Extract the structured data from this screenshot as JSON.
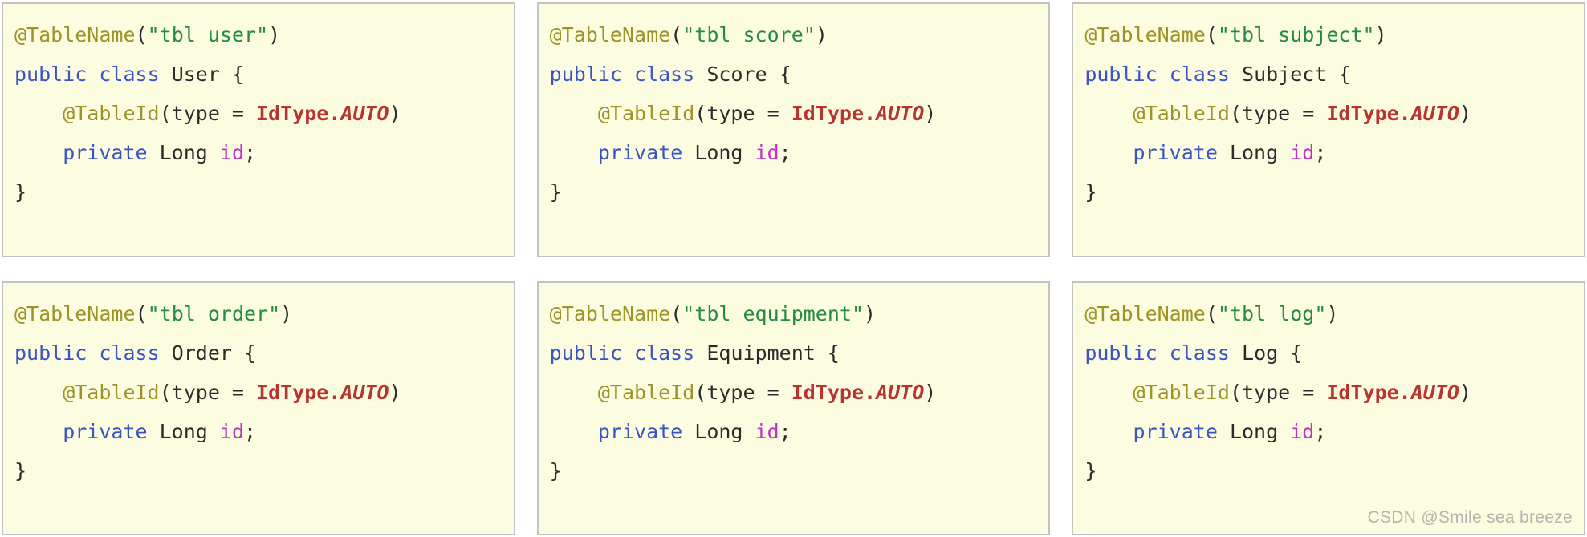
{
  "watermark": "CSDN @Smile sea breeze",
  "syntax_colors": {
    "background": "#fcfce0",
    "border": "#c3c3c3",
    "annotation": "#9e9326",
    "string": "#248c3f",
    "keyword": "#3a53c8",
    "constant": "#b9342f",
    "field": "#c033c0",
    "plain": "#2b2b2b"
  },
  "panels": [
    {
      "table_name": "tbl_user",
      "class_name": "User",
      "lines": {
        "annotation_name": "@TableName",
        "open_paren": "(",
        "quote": "\"",
        "close_paren": ")",
        "keyword_public": "public",
        "keyword_class": "class",
        "open_brace": "{",
        "close_brace": "}",
        "annotation_id": "@TableId",
        "id_args_prefix": "(type = ",
        "id_type": "IdType.",
        "id_auto": "AUTO",
        "keyword_private": "private",
        "field_type": "Long",
        "field_name": "id",
        "semicolon": ";"
      }
    },
    {
      "table_name": "tbl_score",
      "class_name": "Score",
      "lines": {
        "annotation_name": "@TableName",
        "open_paren": "(",
        "quote": "\"",
        "close_paren": ")",
        "keyword_public": "public",
        "keyword_class": "class",
        "open_brace": "{",
        "close_brace": "}",
        "annotation_id": "@TableId",
        "id_args_prefix": "(type = ",
        "id_type": "IdType.",
        "id_auto": "AUTO",
        "keyword_private": "private",
        "field_type": "Long",
        "field_name": "id",
        "semicolon": ";"
      }
    },
    {
      "table_name": "tbl_subject",
      "class_name": "Subject",
      "lines": {
        "annotation_name": "@TableName",
        "open_paren": "(",
        "quote": "\"",
        "close_paren": ")",
        "keyword_public": "public",
        "keyword_class": "class",
        "open_brace": "{",
        "close_brace": "}",
        "annotation_id": "@TableId",
        "id_args_prefix": "(type = ",
        "id_type": "IdType.",
        "id_auto": "AUTO",
        "keyword_private": "private",
        "field_type": "Long",
        "field_name": "id",
        "semicolon": ";"
      }
    },
    {
      "table_name": "tbl_order",
      "class_name": "Order",
      "lines": {
        "annotation_name": "@TableName",
        "open_paren": "(",
        "quote": "\"",
        "close_paren": ")",
        "keyword_public": "public",
        "keyword_class": "class",
        "open_brace": "{",
        "close_brace": "}",
        "annotation_id": "@TableId",
        "id_args_prefix": "(type = ",
        "id_type": "IdType.",
        "id_auto": "AUTO",
        "keyword_private": "private",
        "field_type": "Long",
        "field_name": "id",
        "semicolon": ";"
      }
    },
    {
      "table_name": "tbl_equipment",
      "class_name": "Equipment",
      "lines": {
        "annotation_name": "@TableName",
        "open_paren": "(",
        "quote": "\"",
        "close_paren": ")",
        "keyword_public": "public",
        "keyword_class": "class",
        "open_brace": "{",
        "close_brace": "}",
        "annotation_id": "@TableId",
        "id_args_prefix": "(type = ",
        "id_type": "IdType.",
        "id_auto": "AUTO",
        "keyword_private": "private",
        "field_type": "Long",
        "field_name": "id",
        "semicolon": ";"
      }
    },
    {
      "table_name": "tbl_log",
      "class_name": "Log",
      "lines": {
        "annotation_name": "@TableName",
        "open_paren": "(",
        "quote": "\"",
        "close_paren": ")",
        "keyword_public": "public",
        "keyword_class": "class",
        "open_brace": "{",
        "close_brace": "}",
        "annotation_id": "@TableId",
        "id_args_prefix": "(type = ",
        "id_type": "IdType.",
        "id_auto": "AUTO",
        "keyword_private": "private",
        "field_type": "Long",
        "field_name": "id",
        "semicolon": ";"
      }
    }
  ]
}
